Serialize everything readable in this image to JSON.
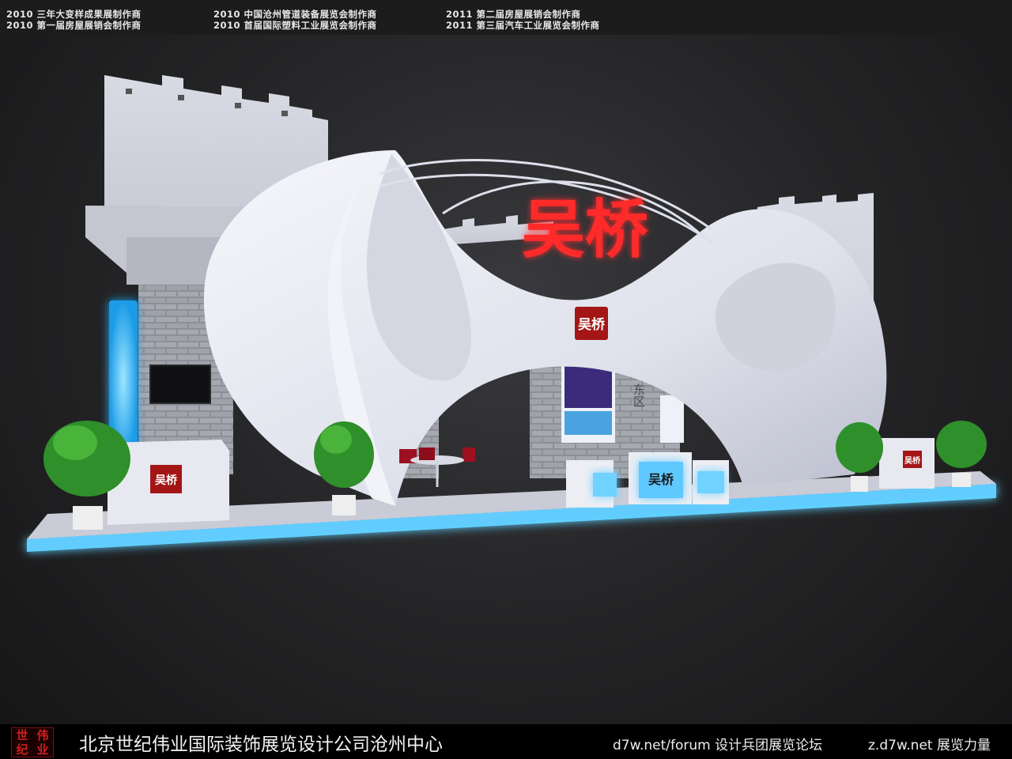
{
  "header": {
    "credits": [
      "2010 三年大变样成果展制作商",
      "2010 中国沧州管道装备展览会制作商",
      "2011 第二届房屋展销会制作商",
      "2010 第一届房屋展销会制作商",
      "2010 首届国际塑料工业展览会制作商",
      "2011 第三届汽车工业展览会制作商"
    ]
  },
  "booth": {
    "brand_sign": "吴桥",
    "brand_badge": "吴桥",
    "left_counter_logo": "吴桥",
    "front_counter_logo": "吴桥",
    "right_counter_logo": "吴桥",
    "zone_label": "东区"
  },
  "footer": {
    "logo_chars": [
      "世",
      "伟",
      "纪",
      "业"
    ],
    "company": "北京世纪伟业国际装饰展览设计公司沧州中心",
    "forum": "d7w.net/forum 设计兵团展览论坛",
    "site": "z.d7w.net 展览力量"
  },
  "colors": {
    "accent_red": "#e81818",
    "glow_blue": "#28b8ff",
    "booth_white": "#e6e8f2"
  }
}
